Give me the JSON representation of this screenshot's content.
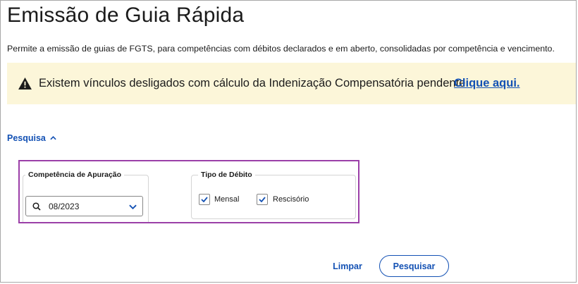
{
  "page": {
    "title": "Emissão de Guia Rápida",
    "description": "Permite a emissão de guias de FGTS, para competências com débitos declarados e em aberto, consolidadas por competência e vencimento."
  },
  "alert": {
    "icon": "warning-icon",
    "message": "Existem vínculos desligados com cálculo da Indenização Compensatória pendente",
    "link_label": "Clique aqui."
  },
  "search": {
    "toggle_label": "Pesquisa",
    "toggle_icon": "chevron-up-icon",
    "competencia": {
      "label": "Competência de Apuração",
      "value": "08/2023"
    },
    "tipo_debito": {
      "label": "Tipo de Débito",
      "options": [
        {
          "label": "Mensal",
          "checked": true
        },
        {
          "label": "Rescisório",
          "checked": true
        }
      ]
    },
    "highlight_color": "#9b3fa8"
  },
  "actions": {
    "clear_label": "Limpar",
    "search_label": "Pesquisar"
  },
  "colors": {
    "link_blue": "#1351b4",
    "alert_background": "#fcf6d9"
  }
}
